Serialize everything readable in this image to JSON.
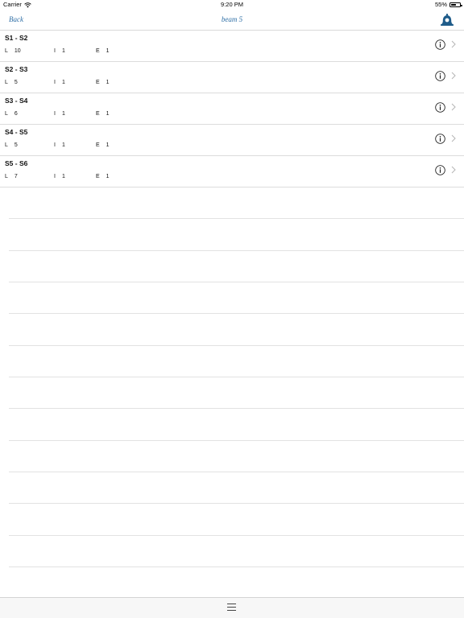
{
  "status_bar": {
    "carrier": "Carrier",
    "time": "9:20 PM",
    "battery": "55%",
    "battery_level": 0.55
  },
  "nav": {
    "back_label": "Back",
    "title": "beam 5"
  },
  "spans": [
    {
      "title": "S1 - S2",
      "L_key": "L",
      "L_val": "10",
      "I_key": "I",
      "I_val": "1",
      "E_key": "E",
      "E_val": "1"
    },
    {
      "title": "S2 - S3",
      "L_key": "L",
      "L_val": "5",
      "I_key": "I",
      "I_val": "1",
      "E_key": "E",
      "E_val": "1"
    },
    {
      "title": "S3 - S4",
      "L_key": "L",
      "L_val": "6",
      "I_key": "I",
      "I_val": "1",
      "E_key": "E",
      "E_val": "1"
    },
    {
      "title": "S4 - S5",
      "L_key": "L",
      "L_val": "5",
      "I_key": "I",
      "I_val": "1",
      "E_key": "E",
      "E_val": "1"
    },
    {
      "title": "S5 - S6",
      "L_key": "L",
      "L_val": "7",
      "I_key": "I",
      "I_val": "1",
      "E_key": "E",
      "E_val": "1"
    }
  ],
  "icons": {
    "bell": "bell-icon",
    "info": "info-icon",
    "chevron": "chevron-right-icon",
    "menu": "hamburger-menu-icon",
    "wifi": "wifi-icon"
  },
  "colors": {
    "accent": "#2f6fa6",
    "bell": "#1f5c8a"
  }
}
